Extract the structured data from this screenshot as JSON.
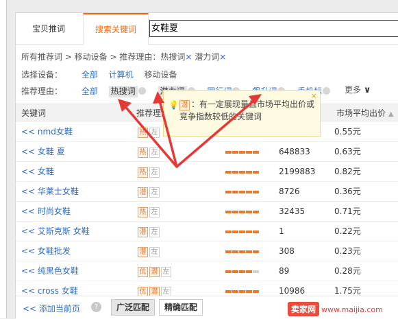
{
  "tabs": [
    {
      "label": "宝贝推词"
    },
    {
      "label": "搜索关键词"
    }
  ],
  "search": {
    "value": "女鞋夏"
  },
  "breadcrumb": {
    "prefix": "所有推荐词 > 移动设备 > 推荐理由：热搜词",
    "close1": "×",
    "mid": "潜力词",
    "close2": "×"
  },
  "device_filter": {
    "label": "选择设备：",
    "options": [
      "全部",
      "计算机",
      "移动设备"
    ]
  },
  "reason_filter": {
    "label": "推荐理由：",
    "options": [
      "全部",
      "热搜词",
      "潜力词",
      "同行词",
      "飙升词",
      "手机标"
    ],
    "more": "更多"
  },
  "table": {
    "headers": {
      "keyword": "关键词",
      "reason": "推荐理由",
      "price": "市场平均出价"
    },
    "rows": [
      {
        "keyword": "<< nmd女鞋",
        "badges": [
          "热",
          "左"
        ],
        "level": 5,
        "searches": "",
        "price": "0.55元"
      },
      {
        "keyword": "<< 女鞋 夏",
        "badges": [
          "热",
          "左"
        ],
        "level": 5,
        "searches": "648833",
        "price": "0.63元"
      },
      {
        "keyword": "<< 女鞋",
        "badges": [
          "热",
          "左"
        ],
        "level": 5,
        "searches": "2199883",
        "price": "0.82元"
      },
      {
        "keyword": "<< 华莱士女鞋",
        "badges": [
          "潜",
          "左"
        ],
        "level": 5,
        "searches": "8726",
        "price": "0.36元"
      },
      {
        "keyword": "<< 时尚女鞋",
        "badges": [
          "热",
          "左"
        ],
        "level": 5,
        "searches": "32435",
        "price": "0.71元"
      },
      {
        "keyword": "<< 艾斯克斯 女鞋",
        "badges": [
          "潜",
          "左"
        ],
        "level": 5,
        "searches": "1",
        "price": "0.22元"
      },
      {
        "keyword": "<< 女鞋批发",
        "badges": [
          "潜",
          "左"
        ],
        "level": 5,
        "searches": "308",
        "price": "0.23元"
      },
      {
        "keyword": "<< 纯黑色女鞋",
        "badges": [
          "优",
          "潜",
          "左"
        ],
        "level": 4,
        "searches": "89",
        "price": "0.28元"
      },
      {
        "keyword": "<< cross 女鞋",
        "badges": [
          "优",
          "潜",
          "左"
        ],
        "level": 5,
        "searches": "10986",
        "price": "1.75元"
      }
    ]
  },
  "tooltip": {
    "badge": "潜",
    "text": "：有一定展现量且市场平均出价或竞争指数较低的关键词",
    "close": "×"
  },
  "footer": {
    "add": "<< 添加当前页",
    "help": "?",
    "broad": "广泛匹配",
    "exact": "精确匹配"
  },
  "watermark": {
    "logo": "卖家网",
    "url": "www.maijia.com"
  },
  "colors": {
    "accent": "#ff6600",
    "link": "#2f6dc1",
    "arrow": "#e53935",
    "bar": "#f07820"
  }
}
